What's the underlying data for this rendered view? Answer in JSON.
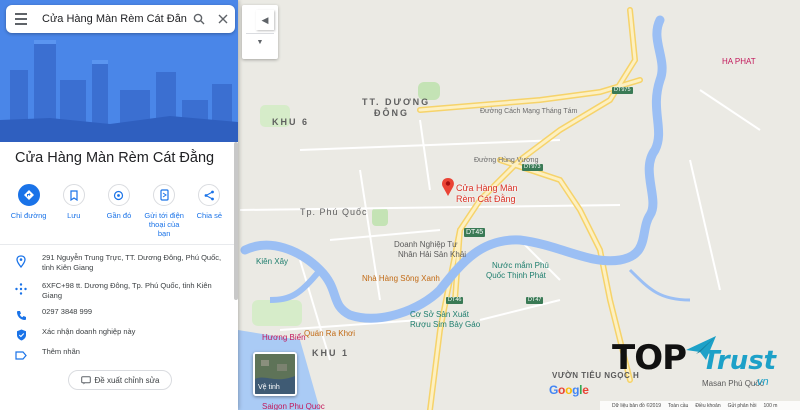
{
  "search": {
    "value": "Cửa Hàng Màn Rèm Cát Đằng"
  },
  "controls": {
    "language_label": "ê"
  },
  "place": {
    "title": "Cửa Hàng Màn Rèm Cát Đằng",
    "actions": [
      {
        "label": "Chỉ đường",
        "icon": "directions-icon"
      },
      {
        "label": "Lưu",
        "icon": "bookmark-icon"
      },
      {
        "label": "Gần đó",
        "icon": "nearby-icon"
      },
      {
        "label": "Gửi tới điện thoại của bạn",
        "icon": "send-to-phone-icon"
      },
      {
        "label": "Chia sẻ",
        "icon": "share-icon"
      }
    ],
    "info": [
      {
        "icon": "location-pin-icon",
        "text": "291 Nguyễn Trung Trực, TT. Dương Đông, Phú Quốc, tỉnh Kiên Giang"
      },
      {
        "icon": "plus-code-icon",
        "text": "6XFC+98 tt. Dương Đông, Tp. Phú Quốc, tỉnh Kiên Giang"
      },
      {
        "icon": "phone-icon",
        "text": "0297 3848 999"
      },
      {
        "icon": "verified-shield-icon",
        "text": "Xác nhận doanh nghiệp này"
      },
      {
        "icon": "label-icon",
        "text": "Thêm nhãn"
      }
    ],
    "suggest_edit_label": "Đề xuất chỉnh sửa"
  },
  "map": {
    "pin_label_line1": "Cửa Hàng Màn",
    "pin_label_line2": "Rèm Cát Đằng",
    "areas": {
      "tt_duong_dong_1": "TT. DƯƠNG",
      "tt_duong_dong_2": "ĐÔNG",
      "khu6": "KHU 6",
      "khu1": "KHU 1",
      "city": "Tp. Phú Quốc"
    },
    "pois": {
      "ha_phat": "HA PHAT",
      "doanh_nghiep_1": "Doanh Nghiệp Tư",
      "doanh_nghiep_2": "Nhân Hải Sản Khải",
      "nuoc_mam_1": "Nước mắm Phú",
      "nuoc_mam_2": "Quốc Thịnh Phát",
      "song_xanh": "Nhà Hàng Sông Xanh",
      "co_so_1": "Cơ Sở Sản Xuất",
      "co_so_2": "Rượu Sim Bảy Gáo",
      "quan_ra_khoi": "Quán Ra Khơi",
      "huong_bien": "Hương Biển",
      "vuon_tieu": "VƯỜN TIÊU NGỌC H",
      "kien_xay": "Kiên Xây",
      "saigon_pq": "Saigon Phu Quoc",
      "masan": "Masan Phú Quốc"
    },
    "streets": {
      "cach_mang": "Đường Cách Mạng Tháng Tám",
      "hung_vuong": "Đường Hùng Vương",
      "dt975": "DT975",
      "dt973": "DT973",
      "dt45": "DT45",
      "dt47": "DT47",
      "dt46": "DT46"
    },
    "satellite_label": "Vệ tinh",
    "google_logo": {
      "g1": "G",
      "o1": "o",
      "o2": "o",
      "g2": "g",
      "l": "l",
      "e": "e"
    },
    "attribution": [
      "Dữ liệu bản đồ ©2019",
      "Toàn cầu",
      "Điều khoản",
      "Gửi phản hồi",
      "100 m"
    ]
  },
  "watermark": {
    "top": "TOP",
    "trust": "Trust",
    "vn": ".vn"
  },
  "colors": {
    "accent": "#1a73e8",
    "hero": "#4a86e8",
    "water": "#8ab4f8",
    "pin": "#d93025",
    "road": "#fbe18a"
  }
}
